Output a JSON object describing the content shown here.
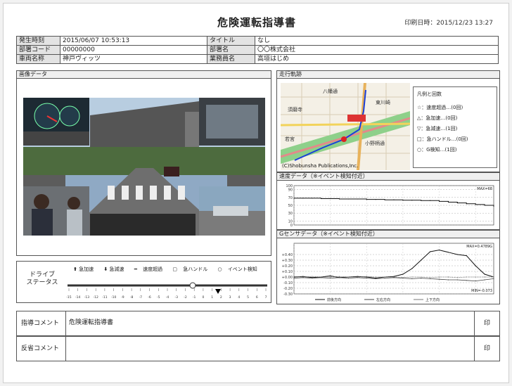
{
  "header": {
    "title": "危険運転指導書",
    "printed_at": "印刷日時：2015/12/23 13:27"
  },
  "info": {
    "occurred_label": "発生時刻",
    "occurred_value": "2015/06/07 10:53:13",
    "title_label": "タイトル",
    "title_value": "なし",
    "dept_code_label": "部署コード",
    "dept_code_value": "00000000",
    "dept_name_label": "部署名",
    "dept_name_value": "〇〇株式会社",
    "vehicle_label": "車両名称",
    "vehicle_value": "神戸ヴィッツ",
    "worker_label": "業務員名",
    "worker_value": "高垣はじめ"
  },
  "image_panel": {
    "label": "画像データ"
  },
  "drive_panel": {
    "label_line1": "ドライブ",
    "label_line2": "ステータス",
    "legend": [
      "急加速",
      "急減速",
      "速度超過",
      "急ハンドル",
      "イベント検知"
    ],
    "ticks": [
      "-15",
      "-14",
      "-13",
      "-12",
      "-11",
      "-10",
      "-9",
      "-8",
      "-7",
      "-6",
      "-5",
      "-4",
      "-3",
      "-2",
      "-1",
      "0",
      "1",
      "2",
      "3",
      "4",
      "5",
      "6",
      "7"
    ]
  },
  "map_panel": {
    "label": "走行軌跡",
    "copyright": "(C)Shobunsha Publications,Inc.",
    "places": [
      "須磨寺",
      "若宮",
      "小野柄通",
      "八幡通",
      "東川崎"
    ],
    "legend_title": "凡例と回数",
    "legend_items": [
      "☆：速度超過…(0回)",
      "△：急加速…(0回)",
      "▽：急減速…(1回)",
      "□：急ハンドル…(0回)",
      "○：G検知…(1回)"
    ]
  },
  "speed_panel": {
    "label": "速度データ（※イベント検知付近）",
    "max_label": "MAX=68"
  },
  "g_panel": {
    "label": "Gセンサデータ（※イベント検知付近）",
    "max_label": "MAX=0.4789G",
    "min_label": "MIN=-0.073",
    "legend": [
      "前後方向",
      "左右方向",
      "上下方向"
    ]
  },
  "comments": {
    "guidance_label": "指導コメント",
    "guidance_value": "危険運転指導書",
    "reflection_label": "反省コメント",
    "reflection_value": "",
    "seal": "印"
  },
  "chart_data": [
    {
      "type": "line",
      "title": "速度データ（※イベント検知付近）",
      "x": [
        -15,
        -14,
        -13,
        -12,
        -11,
        -10,
        -9,
        -8,
        -7,
        -6,
        -5,
        -4,
        -3,
        -2,
        -1,
        0,
        1,
        2,
        3,
        4,
        5,
        6,
        7
      ],
      "ylim": [
        0,
        100
      ],
      "yticks": [
        0,
        10,
        30,
        50,
        70,
        90,
        100
      ],
      "series": [
        {
          "values": [
            68,
            68,
            68,
            67,
            67,
            66,
            66,
            66,
            65,
            65,
            64,
            64,
            63,
            63,
            62,
            62,
            60,
            58,
            56,
            54,
            52,
            50,
            48
          ]
        }
      ]
    },
    {
      "type": "line",
      "title": "Gセンサデータ（※イベント検知付近）",
      "x": [
        -15,
        -14,
        -13,
        -12,
        -11,
        -10,
        -9,
        -8,
        -7,
        -6,
        -5,
        -4,
        -3,
        -2,
        -1,
        0,
        1,
        2,
        3,
        4,
        5,
        6,
        7
      ],
      "ylim": [
        -0.3,
        0.6
      ],
      "yticks": [
        -0.3,
        -0.2,
        -0.1,
        0.0,
        0.1,
        0.2,
        0.3,
        0.4
      ],
      "series": [
        {
          "name": "前後方向",
          "values": [
            0.0,
            0.01,
            -0.01,
            0.0,
            0.02,
            -0.01,
            0.0,
            0.01,
            0.0,
            -0.02,
            0.0,
            0.01,
            0.05,
            0.15,
            0.3,
            0.45,
            0.48,
            0.44,
            0.4,
            0.38,
            0.2,
            0.05,
            0.0
          ]
        },
        {
          "name": "左右方向",
          "values": [
            -0.02,
            -0.01,
            -0.02,
            -0.01,
            -0.02,
            -0.01,
            -0.02,
            -0.01,
            -0.02,
            -0.03,
            -0.02,
            -0.01,
            -0.02,
            -0.03,
            -0.02,
            -0.03,
            -0.04,
            -0.05,
            -0.05,
            -0.06,
            -0.07,
            -0.05,
            -0.03
          ]
        },
        {
          "name": "上下方向",
          "values": [
            0.01,
            0.0,
            0.01,
            0.0,
            0.0,
            0.01,
            0.0,
            0.0,
            0.01,
            0.0,
            0.0,
            0.0,
            -0.01,
            0.0,
            0.0,
            -0.01,
            0.0,
            0.0,
            -0.01,
            0.0,
            0.0,
            0.0,
            0.0
          ]
        }
      ]
    }
  ]
}
